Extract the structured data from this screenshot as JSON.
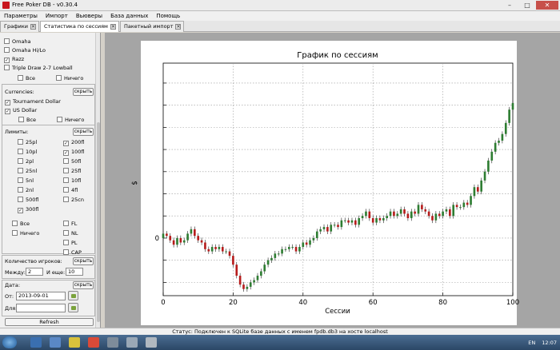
{
  "window": {
    "title": "Free Poker DB - v0.30.4",
    "controls": [
      "–",
      "□",
      "✕"
    ]
  },
  "menu": [
    "Параметры",
    "Импорт",
    "Вьюверы",
    "База данных",
    "Помощь"
  ],
  "tabs": [
    {
      "label": "Графики",
      "close": "✕"
    },
    {
      "label": "Статистика по сессиям",
      "close": "✕"
    },
    {
      "label": "Пакетный импорт",
      "close": "✕"
    }
  ],
  "filters": {
    "games": [
      {
        "label": "Omaha",
        "checked": false
      },
      {
        "label": "Omaha Hi/Lo",
        "checked": false
      },
      {
        "label": "Razz",
        "checked": true
      },
      {
        "label": "Triple Draw 2-7 Lowball",
        "checked": false
      }
    ],
    "games_all": "Все",
    "games_none": "Ничего",
    "currencies_label": "Currencies:",
    "currencies_hide": "скрыть",
    "currencies": [
      {
        "label": "Tournament Dollar",
        "checked": true
      },
      {
        "label": "US Dollar",
        "checked": true
      }
    ],
    "currencies_all": "Все",
    "currencies_none": "Ничего",
    "limits_label": "Лимиты:",
    "limits_hide": "скрыть",
    "limits_left": [
      {
        "label": "25pl",
        "checked": false
      },
      {
        "label": "10pl",
        "checked": false
      },
      {
        "label": "2pl",
        "checked": false
      },
      {
        "label": "25nl",
        "checked": false
      },
      {
        "label": "5nl",
        "checked": false
      },
      {
        "label": "2nl",
        "checked": false
      },
      {
        "label": "500fl",
        "checked": false
      },
      {
        "label": "300fl",
        "checked": true
      }
    ],
    "limits_right": [
      {
        "label": "200fl",
        "checked": true
      },
      {
        "label": "100fl",
        "checked": true
      },
      {
        "label": "50fl",
        "checked": false
      },
      {
        "label": "25fl",
        "checked": false
      },
      {
        "label": "10fl",
        "checked": false
      },
      {
        "label": "4fl",
        "checked": false
      },
      {
        "label": "25cn",
        "checked": false
      }
    ],
    "limits_all": "Все",
    "limits_none": "Ничего",
    "limit_types": [
      "FL",
      "NL",
      "PL",
      "CAP"
    ],
    "players_label": "Количество игроков:",
    "players_hide": "скрыть",
    "between_label": "Между:",
    "between_value": "2",
    "and_label": "И еще:",
    "and_value": "10",
    "date_label": "Дата:",
    "date_hide": "скрыть",
    "from_label": "От:",
    "from_value": "2013-09-01",
    "to_label": "Для:",
    "to_value": "",
    "refresh_label": "Refresh"
  },
  "chart_data": {
    "type": "candlestick",
    "title": "График по сессиям",
    "xlabel": "Сессии",
    "ylabel": "$",
    "xlim": [
      0,
      100
    ],
    "xticks": [
      0,
      20,
      40,
      60,
      80,
      100
    ],
    "ytick_labels": [
      "0"
    ],
    "grid": true,
    "up_color": "#2e7d32",
    "down_color": "#b71c1c",
    "series_close": [
      0.2,
      0.1,
      -0.1,
      -0.3,
      0.0,
      -0.2,
      -0.1,
      0.2,
      0.4,
      0.1,
      -0.1,
      -0.2,
      -0.5,
      -0.6,
      -0.4,
      -0.5,
      -0.4,
      -0.6,
      -0.6,
      -0.8,
      -1.2,
      -1.7,
      -2.1,
      -2.3,
      -2.2,
      -2.0,
      -1.9,
      -1.7,
      -1.5,
      -1.2,
      -1.0,
      -0.9,
      -0.7,
      -0.7,
      -0.5,
      -0.5,
      -0.4,
      -0.4,
      -0.6,
      -0.4,
      -0.2,
      -0.3,
      -0.1,
      0.0,
      0.3,
      0.4,
      0.5,
      0.3,
      0.6,
      0.6,
      0.5,
      0.8,
      0.8,
      0.7,
      0.8,
      0.6,
      0.9,
      1.0,
      1.2,
      0.9,
      0.7,
      0.9,
      0.8,
      0.9,
      1.0,
      1.2,
      1.0,
      1.1,
      1.3,
      1.1,
      0.9,
      1.2,
      1.1,
      1.5,
      1.3,
      1.2,
      1.0,
      0.8,
      1.1,
      1.0,
      1.2,
      1.3,
      1.0,
      1.5,
      1.4,
      1.4,
      1.6,
      1.5,
      1.9,
      2.3,
      2.1,
      2.6,
      3.0,
      3.5,
      3.9,
      4.3,
      4.4,
      4.7,
      5.2,
      5.8,
      6.1
    ]
  },
  "status": "Статус: Подключен к SQLite базе данных с именем fpdb.db3 на хосте localhost",
  "taskbar": {
    "lang": "EN",
    "time": "12:07"
  }
}
